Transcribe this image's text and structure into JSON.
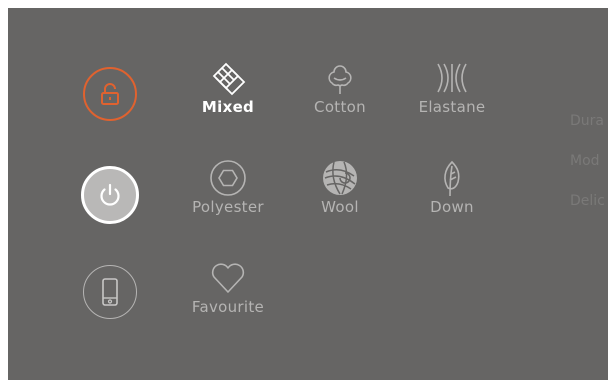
{
  "colors": {
    "background": "#666564",
    "accent": "#e0622f",
    "inactive": "#b5b4b3",
    "active": "#ffffff",
    "faded": "#7a7978"
  },
  "controls": {
    "lock": {
      "icon": "lock-open-icon"
    },
    "power": {
      "icon": "power-icon"
    },
    "phone": {
      "icon": "smartphone-icon"
    }
  },
  "programs": [
    {
      "label": "Mixed",
      "icon": "mixed-fabric-icon",
      "active": true
    },
    {
      "label": "Cotton",
      "icon": "cotton-flower-icon",
      "active": false
    },
    {
      "label": "Elastane",
      "icon": "elastane-icon",
      "active": false
    },
    {
      "label": "Polyester",
      "icon": "polyester-icon",
      "active": false
    },
    {
      "label": "Wool",
      "icon": "wool-ball-icon",
      "active": false
    },
    {
      "label": "Down",
      "icon": "feather-icon",
      "active": false
    },
    {
      "label": "Favourite",
      "icon": "heart-icon",
      "active": false
    }
  ],
  "side_menu": [
    "Dura",
    "Mod",
    "Delic"
  ]
}
